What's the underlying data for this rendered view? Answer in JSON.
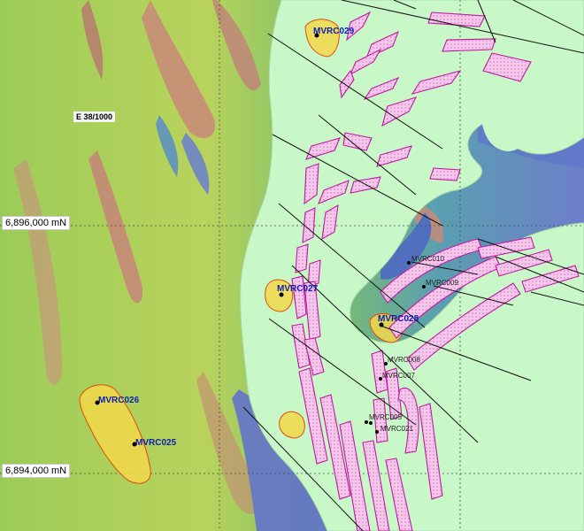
{
  "map": {
    "sheet_label": "E 38/1000",
    "northings": [
      "6,896,000 mN",
      "6,894,000 mN"
    ],
    "colors": {
      "lake_fill": "#c8f7c8",
      "target_fill": "#f2d84a",
      "target_outline": "#e04a10",
      "lens_outline": "#c01aa0",
      "lens_fill": "#f7c6ec",
      "collar_label_major": "#0a1fb5"
    },
    "drill_holes_major": [
      "MVRC029",
      "MVRC027",
      "MVRC028",
      "MVRC026",
      "MVRC025"
    ],
    "drill_holes_minor": [
      "MVRC010",
      "MVRC009",
      "MVRC008",
      "MVRC007",
      "MVRC005",
      "MVRC021"
    ],
    "icons": [
      "drill-collar-icon",
      "drill-trace-icon",
      "grid-line-icon"
    ]
  }
}
